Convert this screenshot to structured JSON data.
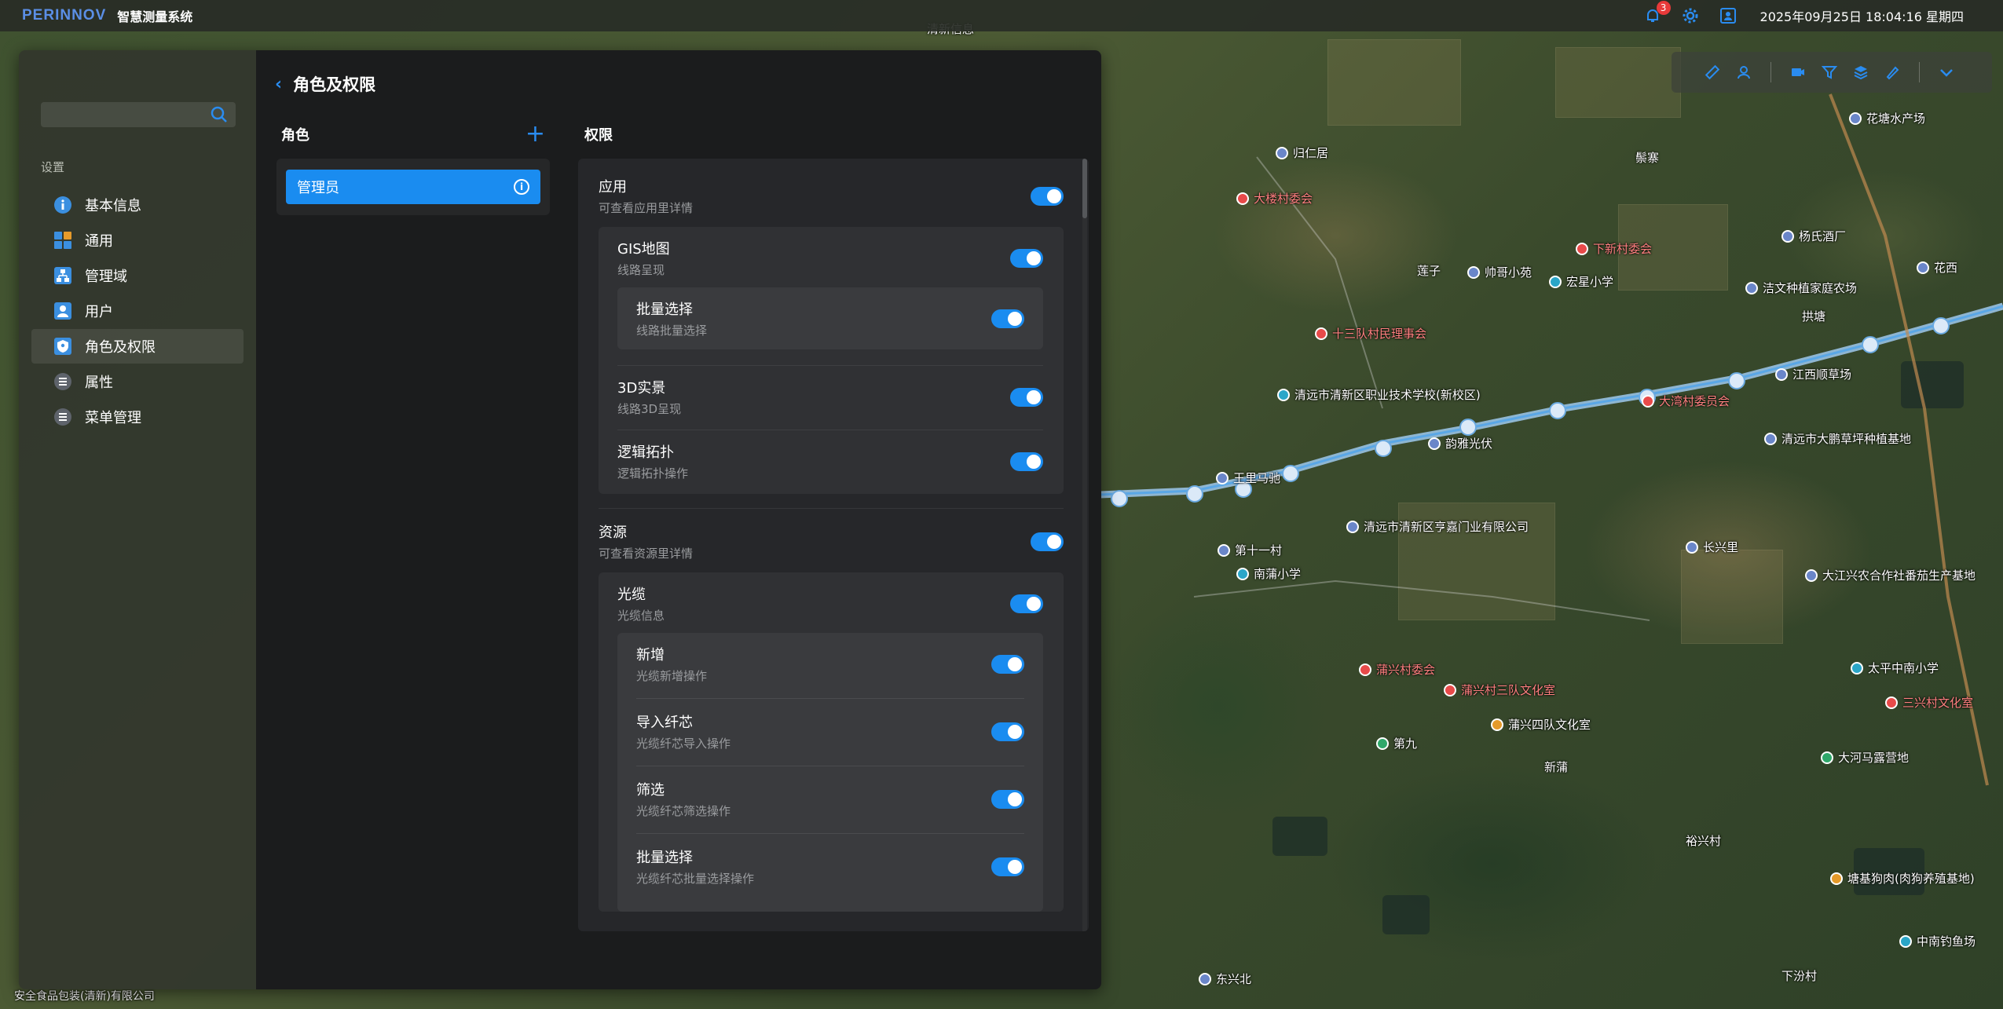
{
  "topbar": {
    "logo": "PERINNOV",
    "system_name": "智慧测量系统",
    "notification_count": "3",
    "datetime": "2025年09月25日 18:04:16 星期四"
  },
  "map": {
    "pois": [
      {
        "label": "归仁居",
        "color": "blue"
      },
      {
        "label": "大楼村委会",
        "color": "red"
      },
      {
        "label": "下新村委会",
        "color": "red"
      },
      {
        "label": "花塘水产场",
        "color": "blue"
      },
      {
        "label": "杨氏酒厂",
        "color": "blue"
      },
      {
        "label": "花西",
        "color": "blue"
      },
      {
        "label": "莲子",
        "color": "plain"
      },
      {
        "label": "帅哥小苑",
        "color": "blue"
      },
      {
        "label": "宏星小学",
        "color": "teal"
      },
      {
        "label": "洁文种植家庭农场",
        "color": "blue"
      },
      {
        "label": "拱塘",
        "color": "plain"
      },
      {
        "label": "十三队村民理事会",
        "color": "red"
      },
      {
        "label": "清远市清新区职业技术学校(新校区)",
        "color": "teal"
      },
      {
        "label": "江西顺草场",
        "color": "blue"
      },
      {
        "label": "清远市大鹏草坪种植基地",
        "color": "blue"
      },
      {
        "label": "大湾村委员会",
        "color": "red"
      },
      {
        "label": "韵雅光伏",
        "color": "blue"
      },
      {
        "label": "王里马驰",
        "color": "blue"
      },
      {
        "label": "清远市清新区亨嘉门业有限公司",
        "color": "blue"
      },
      {
        "label": "第十一村",
        "color": "blue"
      },
      {
        "label": "南蒲小学",
        "color": "teal"
      },
      {
        "label": "长兴里",
        "color": "blue"
      },
      {
        "label": "大江兴农合作社番茄生产基地",
        "color": "blue"
      },
      {
        "label": "太平中南小学",
        "color": "teal"
      },
      {
        "label": "蒲兴村委会",
        "color": "red"
      },
      {
        "label": "蒲兴村三队文化室",
        "color": "red"
      },
      {
        "label": "三兴村文化室",
        "color": "red"
      },
      {
        "label": "蒲兴四队文化室",
        "color": "orange"
      },
      {
        "label": "第九",
        "color": "green"
      },
      {
        "label": "大河马露营地",
        "color": "green"
      },
      {
        "label": "新蒲",
        "color": "plain"
      },
      {
        "label": "裕兴村",
        "color": "plain"
      },
      {
        "label": "塘基狗肉(肉狗养殖基地)",
        "color": "orange"
      },
      {
        "label": "中南钓鱼场",
        "color": "teal"
      },
      {
        "label": "东兴北",
        "color": "blue"
      },
      {
        "label": "下汾村",
        "color": "plain"
      },
      {
        "label": "鬃寨",
        "color": "plain"
      },
      {
        "label": "清新信息",
        "color": "plain"
      },
      {
        "label": "安全食品包装(清新)有限公司",
        "color": "plain"
      }
    ]
  },
  "panel": {
    "search_placeholder": "",
    "sidebar_section": "设置",
    "sidebar_items": [
      {
        "label": "基本信息",
        "icon": "info-icon"
      },
      {
        "label": "通用",
        "icon": "grid-icon"
      },
      {
        "label": "管理域",
        "icon": "hierarchy-icon"
      },
      {
        "label": "用户",
        "icon": "user-icon"
      },
      {
        "label": "角色及权限",
        "icon": "shield-icon",
        "active": true
      },
      {
        "label": "属性",
        "icon": "list-icon"
      },
      {
        "label": "菜单管理",
        "icon": "menu-icon"
      }
    ],
    "page_title": "角色及权限",
    "roles_title": "角色",
    "roles": [
      {
        "label": "管理员",
        "selected": true
      }
    ],
    "perm_title": "权限",
    "permissions": {
      "app": {
        "title": "应用",
        "desc": "可查看应用里详情",
        "enabled": true
      },
      "gis": {
        "title": "GIS地图",
        "desc": "线路呈现",
        "enabled": true
      },
      "gis_batch": {
        "title": "批量选择",
        "desc": "线路批量选择",
        "enabled": true
      },
      "real3d": {
        "title": "3D实景",
        "desc": "线路3D呈现",
        "enabled": true
      },
      "topo": {
        "title": "逻辑拓扑",
        "desc": "逻辑拓扑操作",
        "enabled": true
      },
      "resource": {
        "title": "资源",
        "desc": "可查看资源里详情",
        "enabled": true
      },
      "cable": {
        "title": "光缆",
        "desc": "光缆信息",
        "enabled": true
      },
      "cable_add": {
        "title": "新增",
        "desc": "光缆新增操作",
        "enabled": true
      },
      "cable_import": {
        "title": "导入纤芯",
        "desc": "光缆纤芯导入操作",
        "enabled": true
      },
      "cable_filter": {
        "title": "筛选",
        "desc": "光缆纤芯筛选操作",
        "enabled": true
      },
      "cable_batch": {
        "title": "批量选择",
        "desc": "光缆纤芯批量选择操作",
        "enabled": true
      }
    }
  },
  "colors": {
    "accent": "#1a8cf0",
    "panel_bg": "#1b1c1d",
    "sidebar_bg": "#32362c"
  }
}
